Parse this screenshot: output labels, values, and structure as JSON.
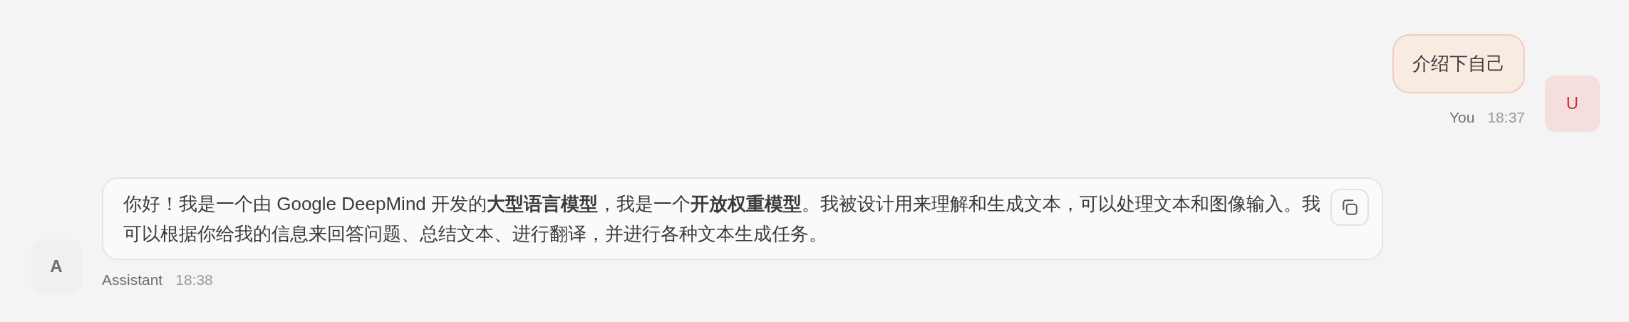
{
  "messages": [
    {
      "kind": "user",
      "avatar": "U",
      "text": "介绍下自己",
      "sender": "You",
      "time": "18:37"
    },
    {
      "kind": "assistant",
      "avatar": "A",
      "text": "你好！我是一个由 Google DeepMind 开发的**大型语言模型**，我是一个**开放权重模型**。我被设计用来理解和生成文本，可以处理文本和图像输入。我可以根据你给我的信息来回答问题、总结文本、进行翻译，并进行各种文本生成任务。",
      "sender": "Assistant",
      "time": "18:38"
    }
  ]
}
